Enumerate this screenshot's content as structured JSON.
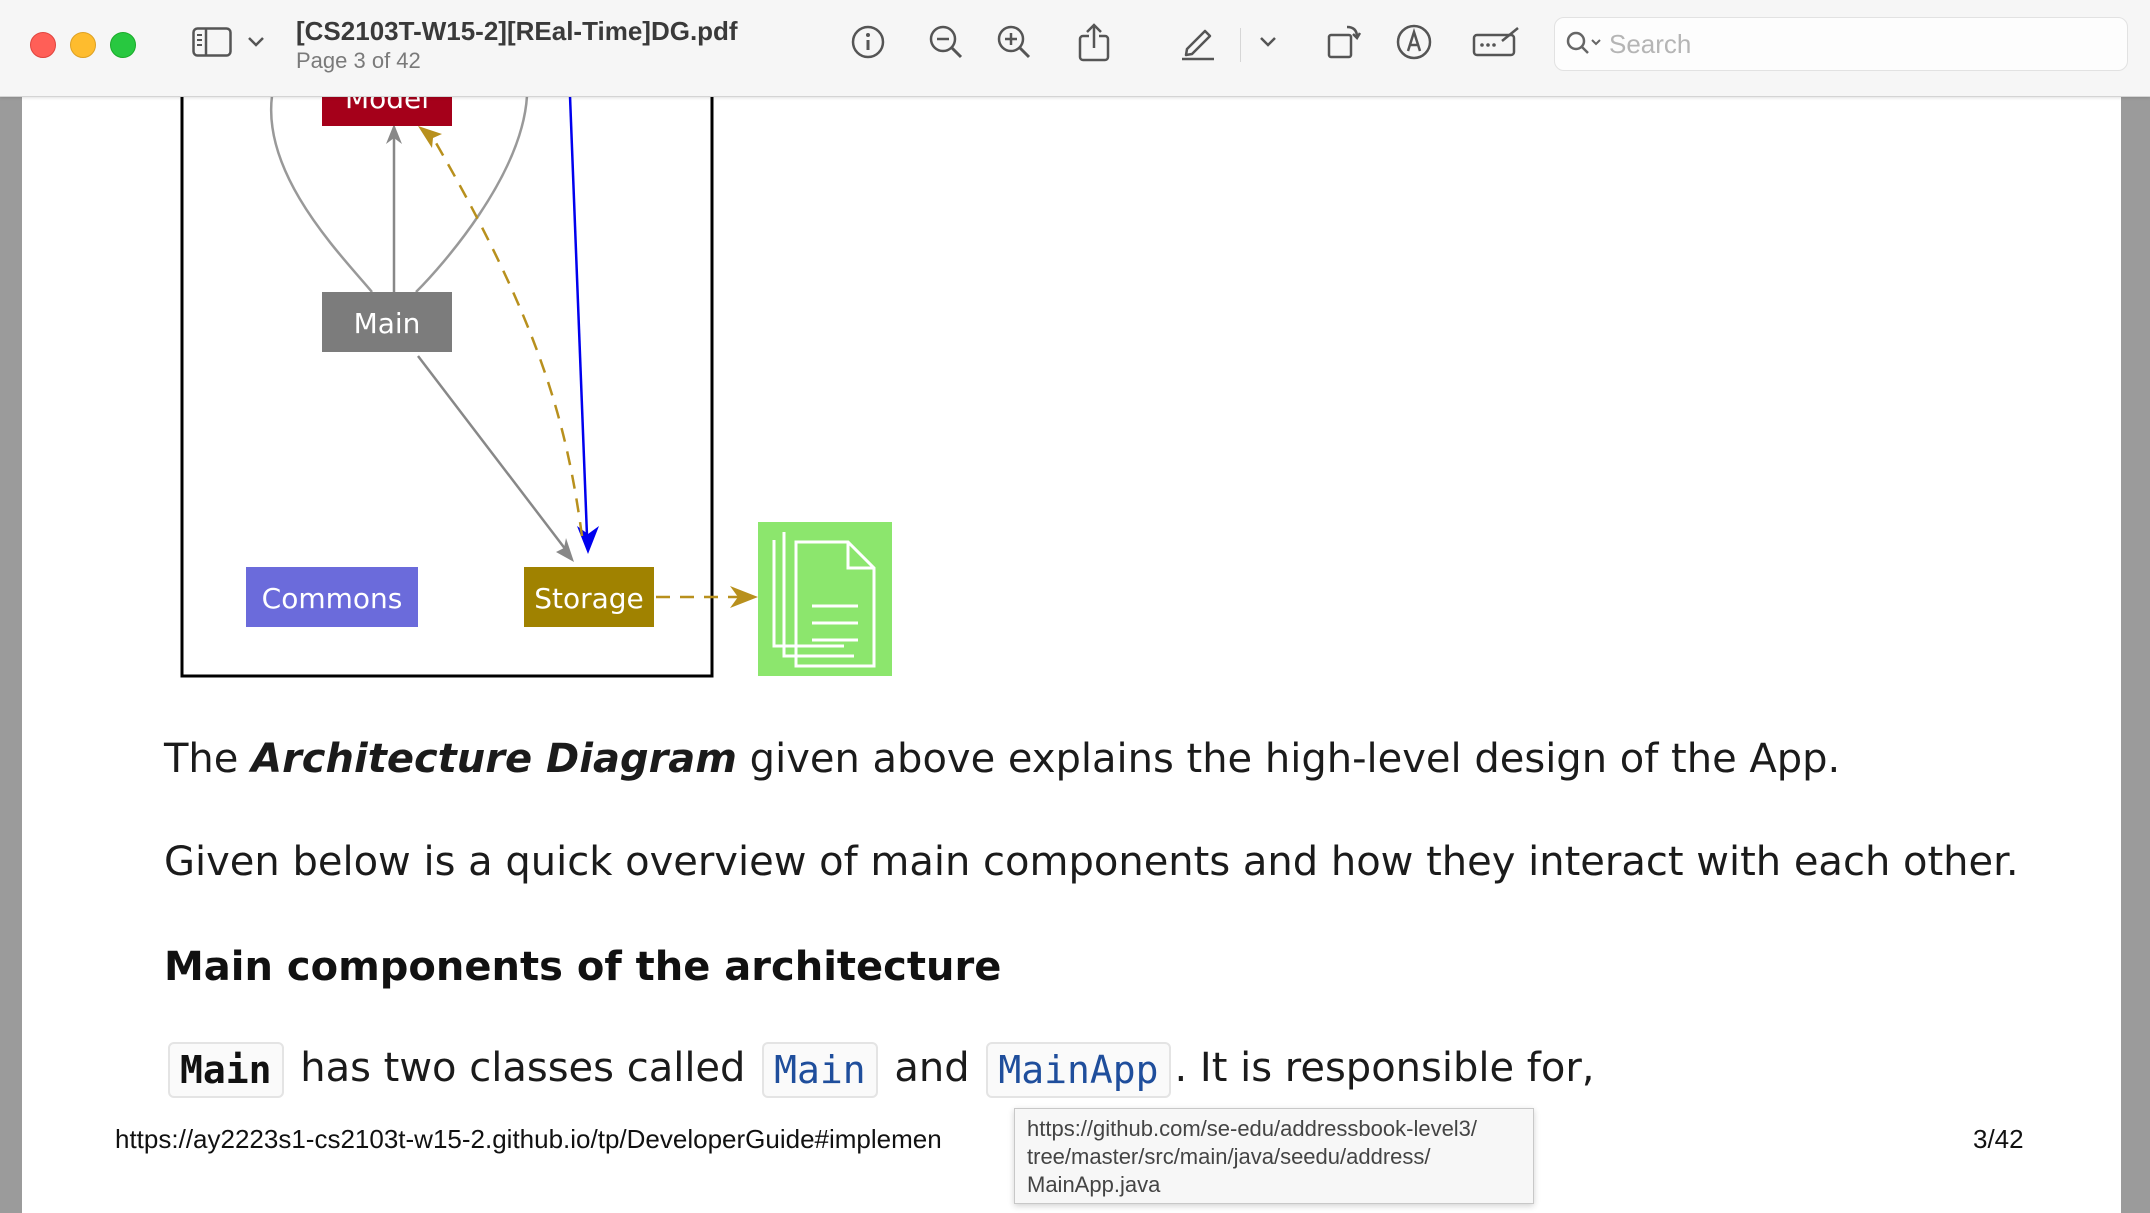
{
  "window": {
    "doc_title": "[CS2103T-W15-2][REal-Time]DG.pdf",
    "page_indicator": "Page 3 of 42"
  },
  "toolbar": {
    "icons": [
      "sidebar-icon",
      "chevron-down-icon",
      "info-icon",
      "zoom-out-icon",
      "zoom-in-icon",
      "share-icon",
      "highlight-pen-icon",
      "chevron-down-icon",
      "rotate-icon",
      "markup-icon",
      "signature-icon",
      "search-icon"
    ],
    "search_placeholder": "Search"
  },
  "diagram": {
    "nodes": {
      "model": "Model",
      "main": "Main",
      "commons": "Commons",
      "storage": "Storage"
    },
    "colors": {
      "model": "#a5001a",
      "main": "#7c7c7c",
      "commons": "#6b6bdb",
      "storage": "#a08200",
      "file": "#8ce66d",
      "link_blue": "#0000ee",
      "dashed": "#b8901d"
    }
  },
  "content": {
    "para1_pre": "The ",
    "para1_emph": "Architecture Diagram",
    "para1_post": " given above explains the high-level design of the App.",
    "para2": "Given below is a quick overview of main components and how they interact with each other.",
    "heading": "Main components of the architecture",
    "line_code1": "Main",
    "line_text1": " has two classes called ",
    "line_code2": "Main",
    "line_text2": " and ",
    "line_code3": "MainApp",
    "line_text3": ". It is responsible for,"
  },
  "footer": {
    "url": "https://ay2223s1-cs2103t-w15-2.github.io/tp/DeveloperGuide#implemen",
    "page": "3/42"
  },
  "tooltip": {
    "line1": "https://github.com/se-edu/addressbook-level3/",
    "line2": "tree/master/src/main/java/seedu/address/",
    "line3": "MainApp.java"
  }
}
